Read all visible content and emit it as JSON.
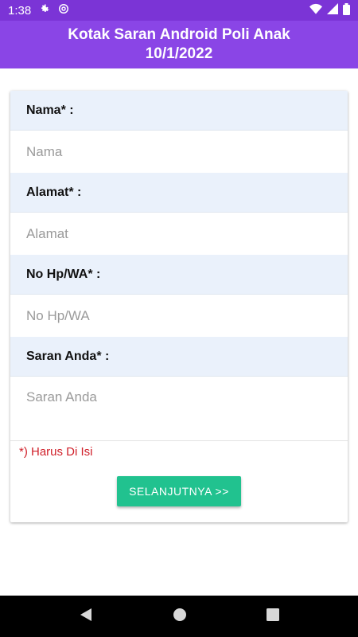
{
  "status_bar": {
    "time": "1:38",
    "icons": [
      "gear-icon",
      "at-icon",
      "wifi-icon",
      "signal-icon",
      "battery-icon"
    ]
  },
  "header": {
    "title_line1": "Kotak Saran Android Poli Anak",
    "title_line2": "10/1/2022"
  },
  "form": {
    "fields": [
      {
        "label": "Nama* :",
        "placeholder": "Nama"
      },
      {
        "label": "Alamat* :",
        "placeholder": "Alamat"
      },
      {
        "label": "No Hp/WA* :",
        "placeholder": "No Hp/WA"
      },
      {
        "label": "Saran Anda* :",
        "placeholder": "Saran Anda"
      }
    ],
    "required_note": "*) Harus Di Isi",
    "next_button_label": "SELANJUTNYA >>"
  },
  "nav_bar": {
    "icons": [
      "back-icon",
      "home-icon",
      "recents-icon"
    ]
  },
  "colors": {
    "status_bar": "#7b34d6",
    "header": "#8a45e6",
    "label_bg": "#eaf1fb",
    "button": "#21c28f",
    "required_text": "#d0202a"
  }
}
